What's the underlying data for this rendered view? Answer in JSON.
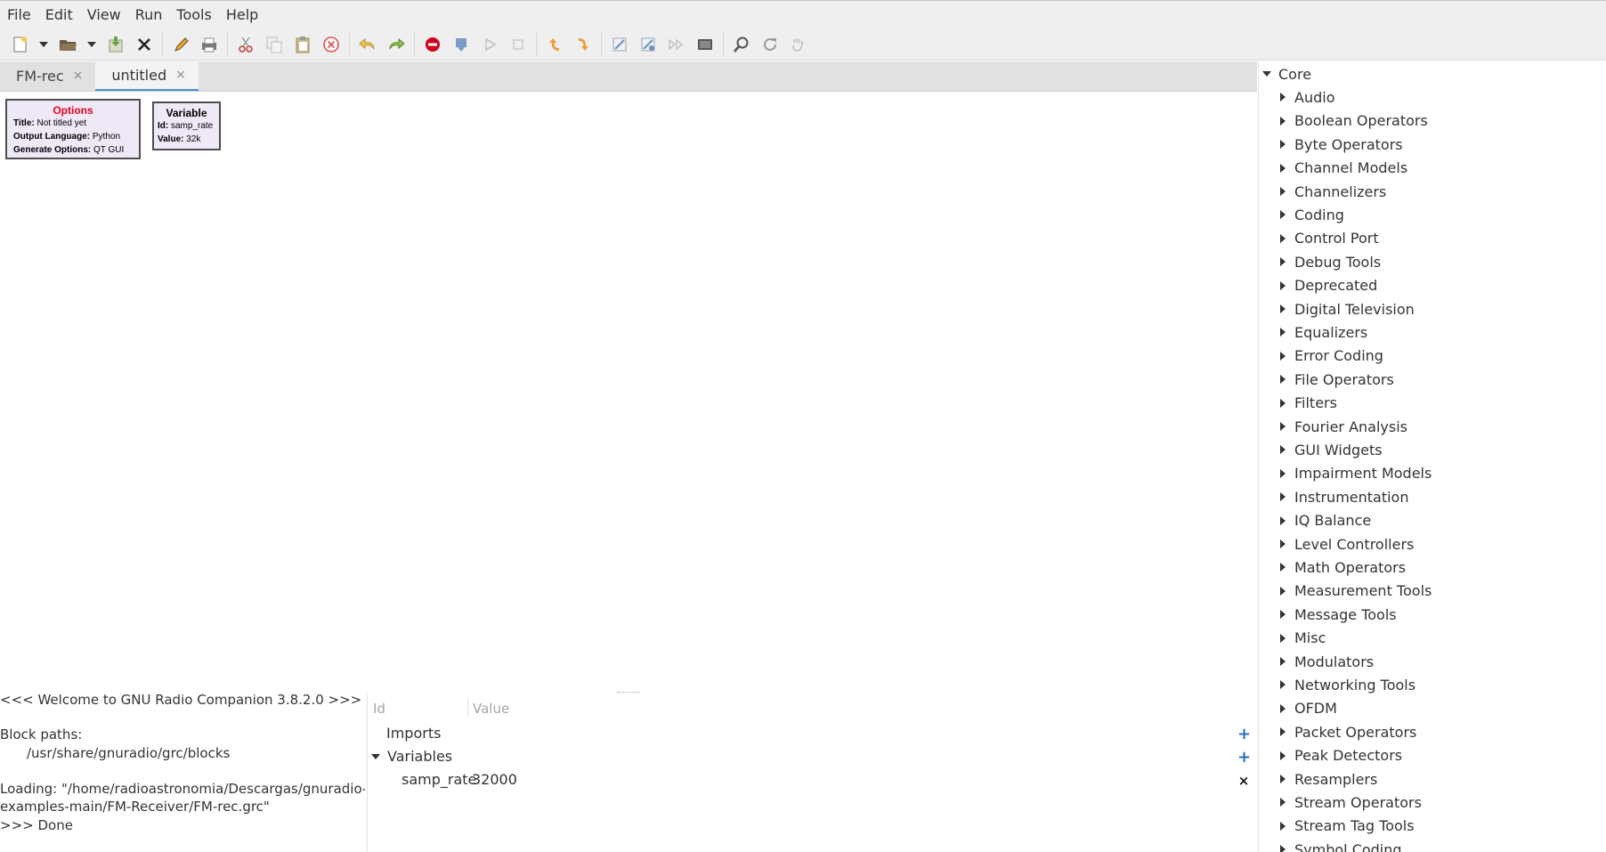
{
  "menubar": {
    "items": [
      "File",
      "Edit",
      "View",
      "Run",
      "Tools",
      "Help"
    ]
  },
  "toolbar": {
    "buttons": [
      "new-icon",
      "open-icon",
      "save-icon",
      "close-icon",
      "edit-icon",
      "print-icon",
      "cut-icon",
      "copy-icon",
      "paste-icon",
      "delete-icon",
      "undo-icon",
      "redo-icon",
      "stop-error-icon",
      "generate-icon",
      "execute-icon",
      "kill-icon",
      "rotate-ccw-icon",
      "rotate-cw-icon",
      "enable-icon",
      "disable-icon",
      "bypass-icon",
      "screenshot-icon",
      "find-icon",
      "reload-icon",
      "parse-icon"
    ]
  },
  "tabs": [
    {
      "label": "FM-rec",
      "close": "×"
    },
    {
      "label": "untitled",
      "close": "×"
    }
  ],
  "canvas": {
    "options_block": {
      "title": "Options",
      "rows": [
        {
          "key": "Title:",
          "value": " Not titled yet"
        },
        {
          "key": "Output Language:",
          "value": " Python"
        },
        {
          "key": "Generate Options:",
          "value": " QT GUI"
        }
      ]
    },
    "variable_block": {
      "title": "Variable",
      "rows": [
        {
          "key": "Id:",
          "value": " samp_rate"
        },
        {
          "key": "Value:",
          "value": " 32k"
        }
      ]
    }
  },
  "console": {
    "lines": [
      "<<< Welcome to GNU Radio Companion 3.8.2.0 >>>",
      "Block paths:",
      "/usr/share/gnuradio/grc/blocks",
      "Loading: \"/home/radioastronomia/Descargas/gnuradio-",
      "examples-main/FM-Receiver/FM-rec.grc\"",
      ">>> Done"
    ]
  },
  "variables_panel": {
    "col_id": "Id",
    "col_value": "Value",
    "imports_label": "Imports",
    "variables_label": "Variables",
    "rows": [
      {
        "id": "samp_rate",
        "value": "32000"
      }
    ],
    "add_symbol": "+",
    "remove_symbol": "×"
  },
  "block_tree": {
    "root": "Core",
    "categories": [
      "Audio",
      "Boolean Operators",
      "Byte Operators",
      "Channel Models",
      "Channelizers",
      "Coding",
      "Control Port",
      "Debug Tools",
      "Deprecated",
      "Digital Television",
      "Equalizers",
      "Error Coding",
      "File Operators",
      "Filters",
      "Fourier Analysis",
      "GUI Widgets",
      "Impairment Models",
      "Instrumentation",
      "IQ Balance",
      "Level Controllers",
      "Math Operators",
      "Measurement Tools",
      "Message Tools",
      "Misc",
      "Modulators",
      "Networking Tools",
      "OFDM",
      "Packet Operators",
      "Peak Detectors",
      "Resamplers",
      "Stream Operators",
      "Stream Tag Tools",
      "Symbol Coding"
    ]
  },
  "colors": {
    "options_title": "#e8001c",
    "block_fill": "#efe8f7",
    "accent_blue": "#4a90d9",
    "plus_blue": "#2a6ec3"
  }
}
